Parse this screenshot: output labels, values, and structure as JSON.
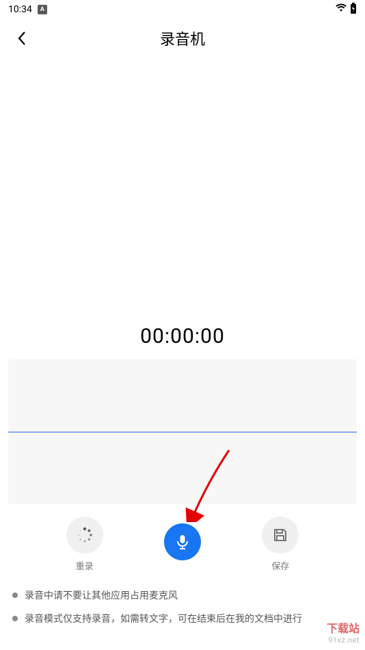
{
  "status_bar": {
    "time": "10:34",
    "icon_a_label": "A"
  },
  "header": {
    "title": "录音机"
  },
  "timer": {
    "display": "00:00:00"
  },
  "controls": {
    "rerecord": {
      "label": "重录"
    },
    "record": {
      "label": ""
    },
    "save": {
      "label": "保存"
    }
  },
  "tips": [
    "录音中请不要让其他应用占用麦克风",
    "录音模式仅支持录音，如需转文字，可在结束后在我的文档中进行"
  ],
  "watermark": {
    "line1": "下载站",
    "line2": "91xz.net"
  }
}
